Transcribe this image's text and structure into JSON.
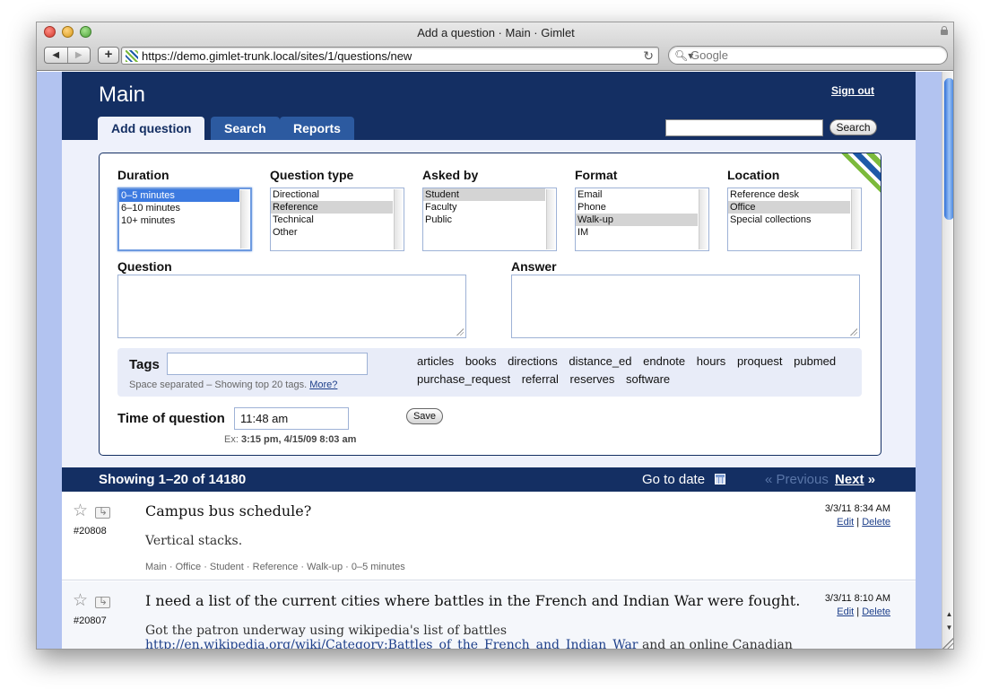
{
  "window": {
    "title": "Add a question · Main · Gimlet"
  },
  "browser": {
    "back_label": "◀",
    "forward_label": "▶",
    "add_label": "+",
    "url": "https://demo.gimlet-trunk.local/sites/1/questions/new",
    "reload_label": "↻",
    "search_placeholder": "Google",
    "search_icon_label": "🔍︎▾"
  },
  "header": {
    "site_title": "Main",
    "signout_label": "Sign out",
    "tabs": [
      {
        "label": "Add question"
      },
      {
        "label": "Search"
      },
      {
        "label": "Reports"
      }
    ],
    "search_button_label": "Search"
  },
  "form": {
    "fields": [
      {
        "label": "Duration",
        "options": [
          "0–5 minutes",
          "6–10 minutes",
          "10+ minutes"
        ],
        "selected": "0–5 minutes"
      },
      {
        "label": "Question type",
        "options": [
          "Directional",
          "Reference",
          "Technical",
          "Other"
        ],
        "selected": "Reference"
      },
      {
        "label": "Asked by",
        "options": [
          "Student",
          "Faculty",
          "Public"
        ],
        "selected": "Student"
      },
      {
        "label": "Format",
        "options": [
          "Email",
          "Phone",
          "Walk-up",
          "IM"
        ],
        "selected": "Walk-up"
      },
      {
        "label": "Location",
        "options": [
          "Reference desk",
          "Office",
          "Special collections"
        ],
        "selected": "Office"
      }
    ],
    "question_label": "Question",
    "answer_label": "Answer",
    "tags_label": "Tags",
    "tags_hint": "Space separated – Showing top 20 tags.",
    "tags_more": "More?",
    "tag_cloud": [
      "articles",
      "books",
      "directions",
      "distance_ed",
      "endnote",
      "hours",
      "proquest",
      "pubmed",
      "purchase_request",
      "referral",
      "reserves",
      "software"
    ],
    "time_label": "Time of question",
    "time_value": "11:48 am",
    "time_hint_prefix": "Ex:",
    "time_hint_examples": "3:15 pm, 4/15/09 8:03 am",
    "save_label": "Save"
  },
  "results": {
    "showing": "Showing 1–20 of 14180",
    "goto_date": "Go to date",
    "previous": "« Previous",
    "next": "Next",
    "next_arrow": "»"
  },
  "entries": [
    {
      "id": "#20808",
      "question": "Campus bus schedule?",
      "answer": "Vertical stacks.",
      "meta": "Main · Office · Student · Reference · Walk-up · 0–5 minutes",
      "datetime": "3/3/11 8:34 AM",
      "edit": "Edit",
      "delete": "Delete"
    },
    {
      "id": "#20807",
      "question": "I need a list of the current cities where battles in the French and Indian War were fought.",
      "answer": "Got the patron underway using wikipedia's list of battles",
      "answer_link": "http://en.wikipedia.org/wiki/Category:Battles_of_the_French_and_Indian_War",
      "answer_tail": "and an online Canadian",
      "datetime": "3/3/11 8:10 AM",
      "edit": "Edit",
      "delete": "Delete"
    }
  ],
  "icons": {
    "star": "☆",
    "calendar": "calendar-icon",
    "forward": "forward-icon"
  },
  "colors": {
    "header_bg": "#142f63",
    "tab_bg": "#2c5aa0",
    "page_bg": "#b2c3f0",
    "form_bg": "#eef1fb",
    "link": "#1d3f8a"
  }
}
